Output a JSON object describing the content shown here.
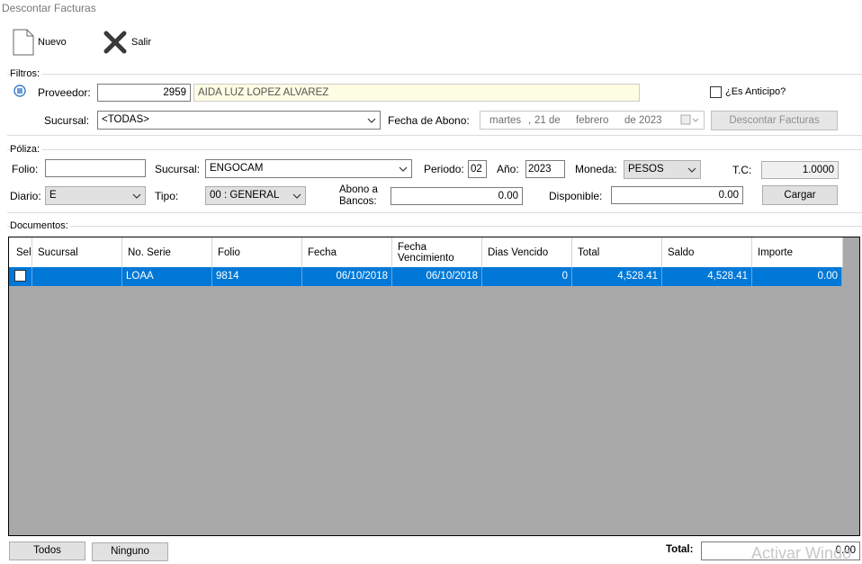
{
  "window": {
    "title": "Descontar Facturas"
  },
  "toolbar": {
    "new_label": "Nuevo",
    "exit_label": "Salir"
  },
  "filtros": {
    "group_label": "Filtros:",
    "proveedor_label": "Proveedor:",
    "proveedor_code": "2959",
    "proveedor_name": "AIDA LUZ LOPEZ ALVAREZ",
    "anticipo_label": "¿Es Anticipo?",
    "sucursal_label": "Sucursal:",
    "sucursal_value": "<TODAS>",
    "fecha_abono_label": "Fecha de Abono:",
    "fecha_weekday": "martes",
    "fecha_day": "21 de",
    "fecha_month": "febrero",
    "fecha_year": "de 2023",
    "descontar_button": "Descontar Facturas"
  },
  "poliza": {
    "group_label": "Póliza:",
    "folio_label": "Folio:",
    "folio_value": "",
    "sucursal_label": "Sucursal:",
    "sucursal_value": "ENGOCAM",
    "periodo_label": "Periodo:",
    "periodo_value": "02",
    "anio_label": "Año:",
    "anio_value": "2023",
    "moneda_label": "Moneda:",
    "moneda_value": "PESOS",
    "tc_label": "T.C:",
    "tc_value": "1.0000",
    "diario_label": "Diario:",
    "diario_value": "E",
    "tipo_label": "Tipo:",
    "tipo_value": "00 : GENERAL",
    "abono_label_1": "Abono a",
    "abono_label_2": "Bancos:",
    "abono_value": "0.00",
    "disponible_label": "Disponible:",
    "disponible_value": "0.00",
    "cargar_button": "Cargar"
  },
  "documentos": {
    "group_label": "Documentos:",
    "columns": {
      "sel": "Sel",
      "sucursal": "Sucursal",
      "no_serie": "No. Serie",
      "folio": "Folio",
      "fecha": "Fecha",
      "fecha_venc_1": "Fecha",
      "fecha_venc_2": "Vencimiento",
      "dias_vencido": "Dias Vencido",
      "total": "Total",
      "saldo": "Saldo",
      "importe": "Importe"
    },
    "rows": [
      {
        "sucursal": "",
        "no_serie": "LOAA",
        "folio": "9814",
        "fecha": "06/10/2018",
        "fecha_vencimiento": "06/10/2018",
        "dias_vencido": "0",
        "total": "4,528.41",
        "saldo": "4,528.41",
        "importe": "0.00"
      }
    ]
  },
  "footer": {
    "todos_button": "Todos",
    "ninguno_button": "Ninguno",
    "total_label": "Total:",
    "total_value": "0.00",
    "watermark": "Activar Windo"
  }
}
